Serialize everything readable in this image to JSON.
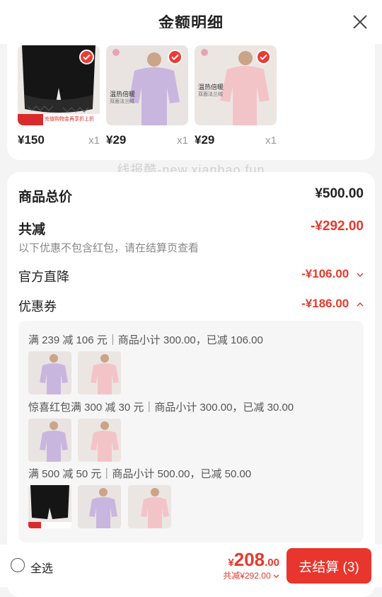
{
  "header": {
    "title": "金额明细"
  },
  "products": [
    {
      "price": "¥150",
      "qty": "x1"
    },
    {
      "price": "¥29",
      "qty": "x1"
    },
    {
      "price": "¥29",
      "qty": "x1"
    }
  ],
  "watermark": "线报酷-new.xianbao.fun",
  "summary": {
    "total_label": "商品总价",
    "total_value": "¥500.00",
    "discount_label": "共减",
    "discount_value": "-¥292.00",
    "note": "以下优惠不包含红包，请在结算页查看",
    "official_label": "官方直降",
    "official_value": "-¥106.00",
    "coupon_label": "优惠券",
    "coupon_value": "-¥186.00"
  },
  "coupons": [
    {
      "text": "满 239 减 106 元｜商品小计 300.00，已减 106.00"
    },
    {
      "text": "惊喜红包满 300 减 30 元｜商品小计 300.00，已减 30.00"
    },
    {
      "text": "满 500 减 50 元｜商品小计 500.00，已减 50.00"
    }
  ],
  "product_tags": {
    "warm_title": "温热倍暖",
    "warm_sub": "双面法兰绒",
    "banner": "充值购物金再享折上折"
  },
  "bottom": {
    "select_all": "全选",
    "currency": "¥",
    "amount_int": "208",
    "amount_dec": ".00",
    "saved": "共减¥292.00",
    "checkout": "去结算 (3)"
  },
  "colors": {
    "accent": "#e8352d",
    "lavender": "#c9b6de",
    "pink": "#f2c4c8",
    "black": "#151515"
  }
}
